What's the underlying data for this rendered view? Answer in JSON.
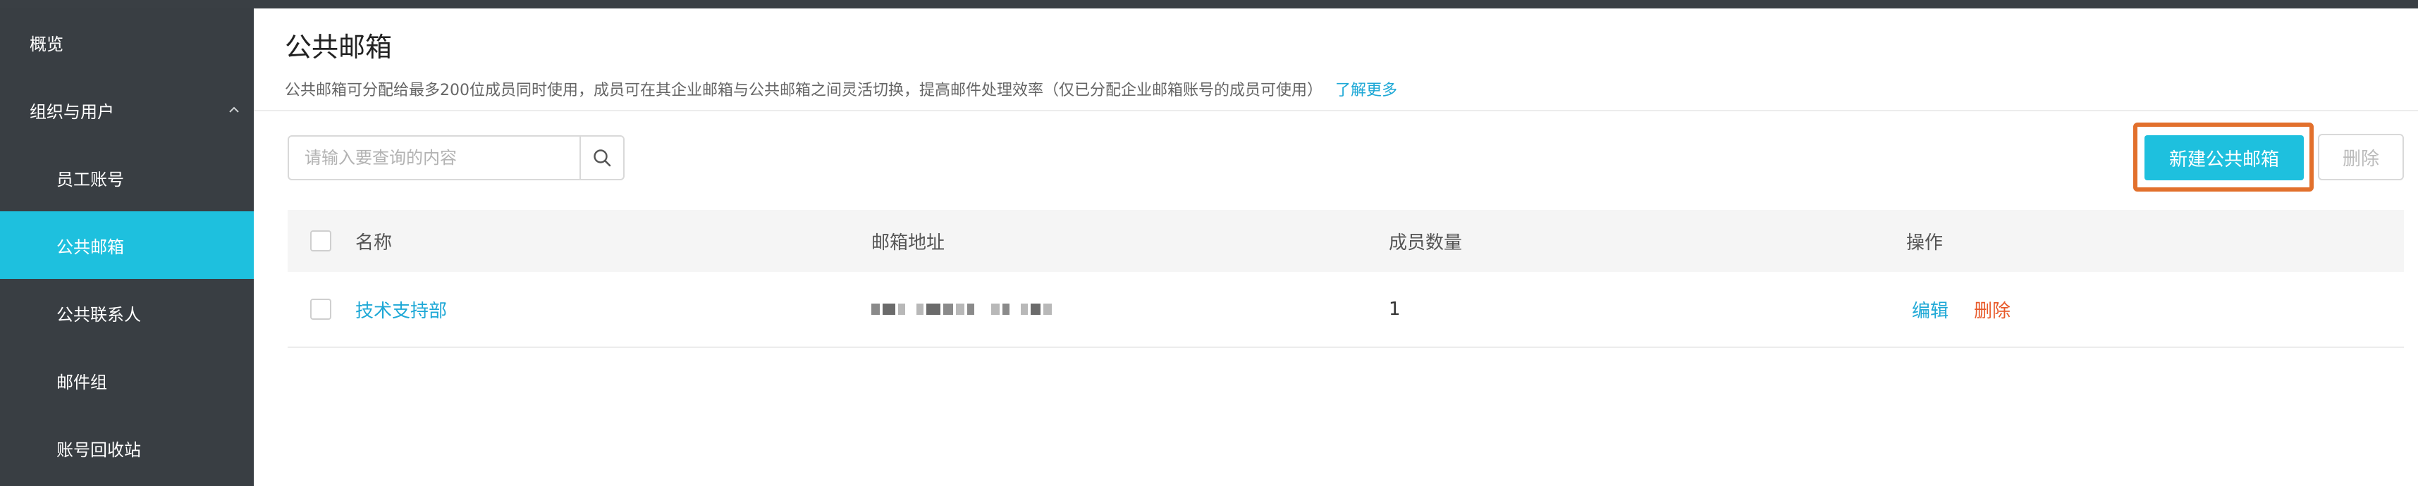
{
  "sidebar": {
    "items": [
      {
        "label": "概览"
      },
      {
        "label": "组织与用户"
      },
      {
        "label": "员工账号"
      },
      {
        "label": "公共邮箱"
      },
      {
        "label": "公共联系人"
      },
      {
        "label": "邮件组"
      },
      {
        "label": "账号回收站"
      }
    ],
    "active_index": 3,
    "accent_color": "#1ec0de"
  },
  "header": {
    "title": "公共邮箱",
    "description": "公共邮箱可分配给最多200位成员同时使用，成员可在其企业邮箱与公共邮箱之间灵活切换，提高邮件处理效率（仅已分配企业邮箱账号的成员可使用）",
    "learn_more": "了解更多"
  },
  "toolbar": {
    "search_placeholder": "请输入要查询的内容",
    "search_icon": "search-icon",
    "new_button": "新建公共邮箱",
    "delete_button": "删除"
  },
  "table": {
    "columns": [
      "名称",
      "邮箱地址",
      "成员数量",
      "操作"
    ],
    "rows": [
      {
        "name": "技术支持部",
        "email": "",
        "members": "1",
        "actions": {
          "edit": "编辑",
          "delete": "删除"
        }
      }
    ]
  },
  "colors": {
    "link": "#1ea8d6",
    "danger": "#e85a2a",
    "highlight_border": "#e2702c",
    "sidebar_bg": "#393e43"
  }
}
